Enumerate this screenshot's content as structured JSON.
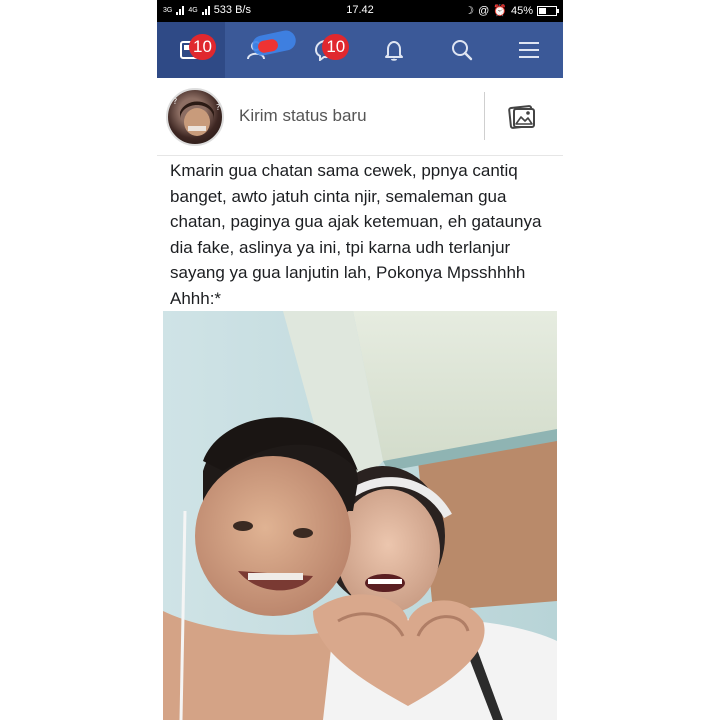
{
  "status_bar": {
    "signal_1": "3G",
    "signal_2": "4G",
    "speed": "533 B/s",
    "time": "17.42",
    "battery": "45%",
    "battery_level": 0.45
  },
  "nav": {
    "tabs": [
      {
        "name": "news-feed",
        "icon": "news-feed-icon",
        "badge": "10"
      },
      {
        "name": "friend-requests",
        "icon": "friends-icon",
        "badge": ""
      },
      {
        "name": "messages",
        "icon": "messenger-icon",
        "badge": "10"
      },
      {
        "name": "notifications",
        "icon": "bell-icon",
        "badge": ""
      },
      {
        "name": "search",
        "icon": "search-icon",
        "badge": ""
      },
      {
        "name": "menu",
        "icon": "menu-icon",
        "badge": ""
      }
    ],
    "accent": "#3b5998",
    "badge_color": "#e0282e"
  },
  "composer": {
    "placeholder": "Kirim status baru",
    "photo_icon": "photo-icon"
  },
  "post": {
    "text": "Kmarin gua chatan sama cewek, ppnya cantiq banget, awto jatuh cinta njir, semaleman gua chatan, paginya gua ajak ketemuan, eh gataunya dia fake, aslinya ya ini, tpi karna udh terlanjur sayang ya gua lanjutin lah, Pokonya Mpsshhhh Ahhh:*"
  }
}
